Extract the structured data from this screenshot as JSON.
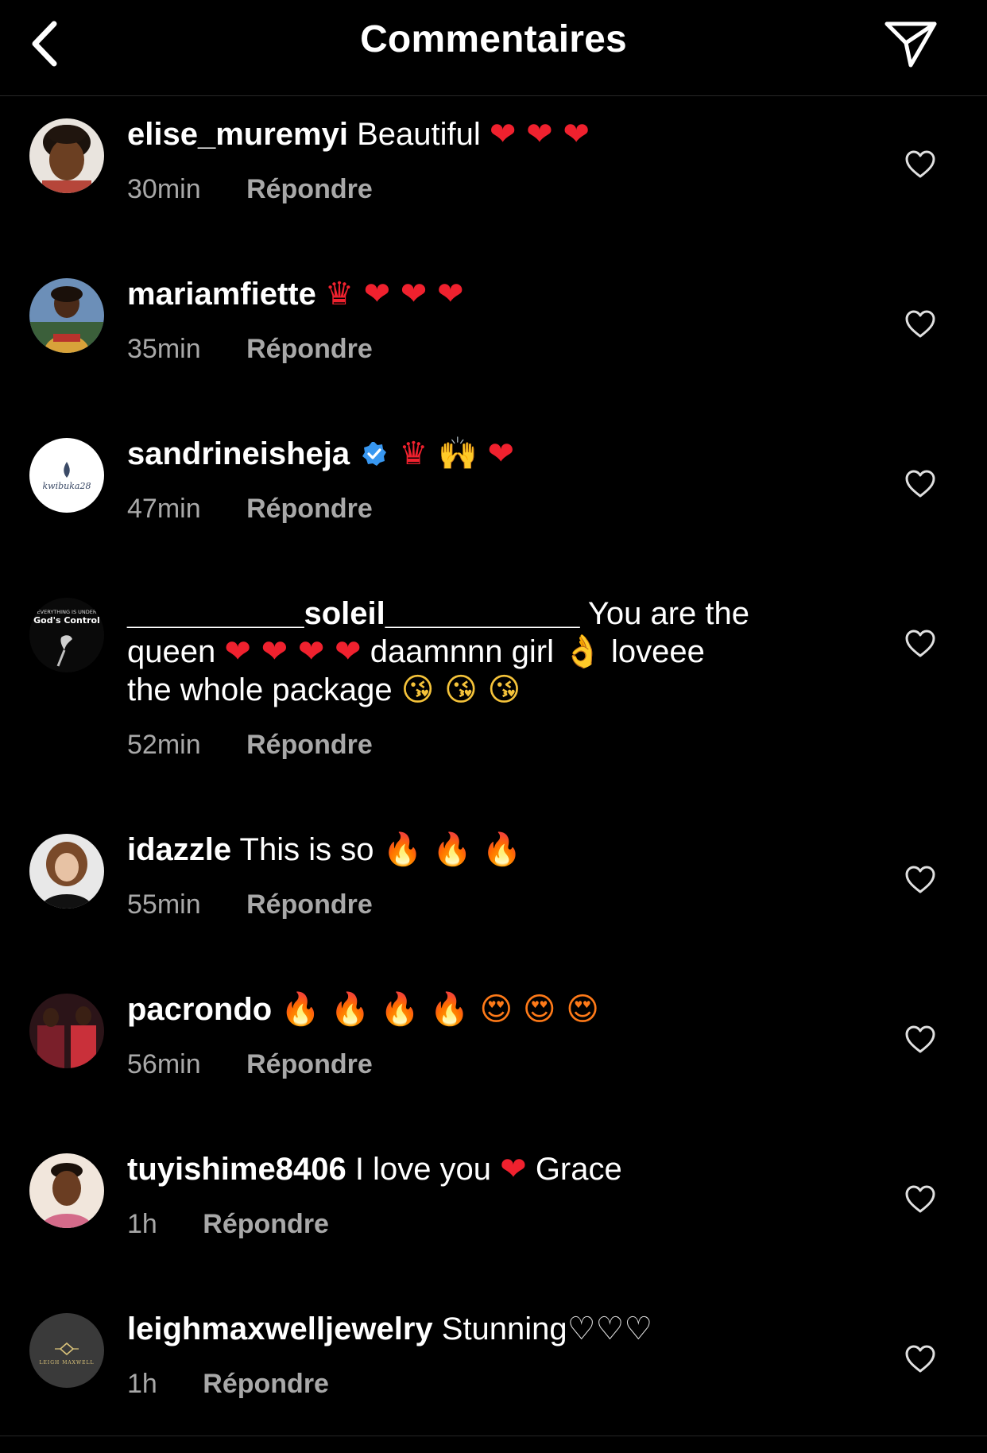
{
  "header": {
    "title": "Commentaires"
  },
  "labels": {
    "reply": "Répondre"
  },
  "comments": [
    {
      "username": "elise_muremyi",
      "text": "Beautiful",
      "emojis": "❤ ❤ ❤",
      "time": "30min"
    },
    {
      "username": "mariamfiette",
      "text": "",
      "emojis": "♛ ❤ ❤ ❤",
      "time": "35min"
    },
    {
      "username": "sandrineisheja",
      "verified": true,
      "text": "",
      "emojis": "♛ 🙌 ❤",
      "time": "47min"
    },
    {
      "username": "__________soleil___________",
      "text_line1": "You are the",
      "text_line2": "queen",
      "emojis_line2a": "❤ ❤ ❤ ❤",
      "text_line2b": "daamnnn girl",
      "emojis_line2c": "👌",
      "text_line2d": "loveee",
      "text_line3": "the whole package",
      "emojis_line3": "😘 😘 😘",
      "time": "52min"
    },
    {
      "username": "idazzle",
      "text": "This is so",
      "emojis": "🔥 🔥 🔥",
      "time": "55min"
    },
    {
      "username": "pacrondo",
      "text": "",
      "emojis": "🔥 🔥 🔥 🔥 😍 😍 😍",
      "time": "56min"
    },
    {
      "username": "tuyishime8406",
      "text": "I love you",
      "emojis": "❤",
      "text_after": "Grace",
      "time": "1h"
    },
    {
      "username": "leighmaxwelljewelry",
      "text": "Stunning",
      "emojis": "♡♡♡",
      "time": "1h"
    }
  ],
  "avatars": {
    "sandrineisheja_logo": "kwibuka28",
    "soleil_logo_top": "EVERYTHING IS UNDER",
    "soleil_logo_bottom": "God's Control",
    "leighmaxwell_logo": "LEIGH MAXWELL"
  },
  "colors": {
    "background": "#000000",
    "secondary_text": "#a8a8a8",
    "heart": "#f0212e",
    "verified": "#3897f0"
  }
}
